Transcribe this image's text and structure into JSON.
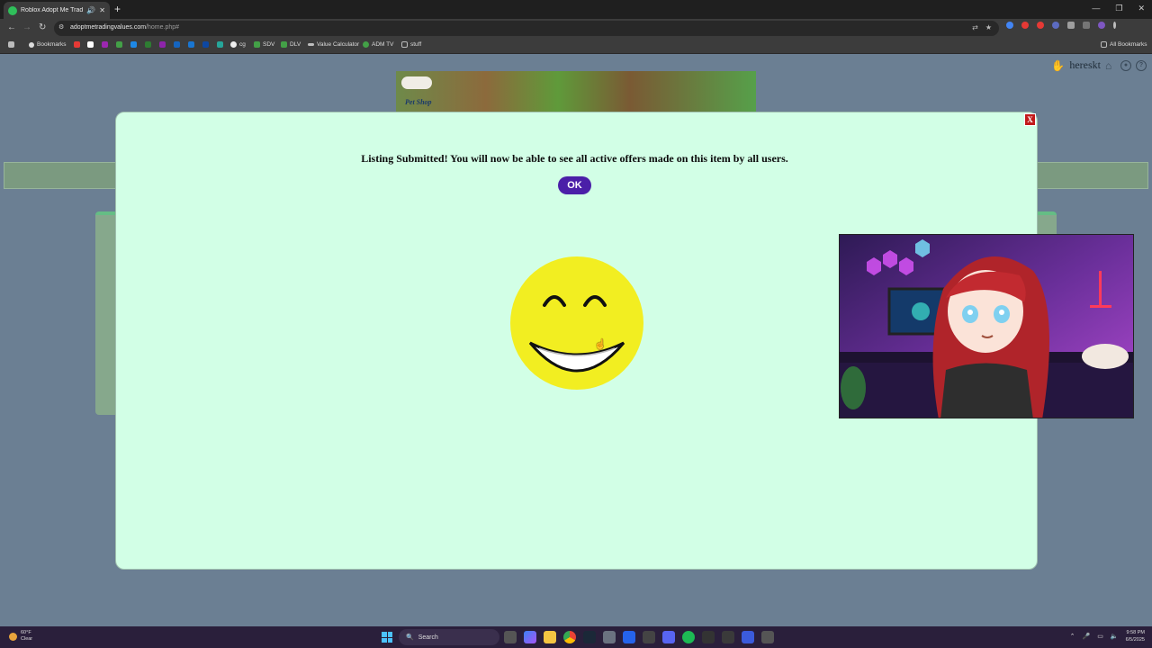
{
  "browser": {
    "tab_title": "Roblox Adopt Me Trading V",
    "url_host": "adoptmetradingvalues.com",
    "url_path": "/home.php#",
    "bookmarks": [
      {
        "label": "Bookmarks",
        "color": "#dddddd"
      },
      {
        "label": "",
        "color": "#e53935"
      },
      {
        "label": "",
        "color": "#ffffff"
      },
      {
        "label": "",
        "color": "#9c27b0"
      },
      {
        "label": "",
        "color": "#43a047"
      },
      {
        "label": "",
        "color": "#1e88e5"
      },
      {
        "label": "",
        "color": "#2e7d32"
      },
      {
        "label": "",
        "color": "#8e24aa"
      },
      {
        "label": "",
        "color": "#1565c0"
      },
      {
        "label": "",
        "color": "#1976d2"
      },
      {
        "label": "",
        "color": "#0d47a1"
      },
      {
        "label": "",
        "color": "#64b5f6"
      },
      {
        "label": "",
        "color": "#26a69a"
      },
      {
        "label": "cg",
        "color": "#eeeeee"
      },
      {
        "label": "SDV",
        "color": "#43a047"
      },
      {
        "label": "DLV",
        "color": "#43a047"
      },
      {
        "label": "Value Calculator",
        "color": "#bdbdbd"
      },
      {
        "label": "ADM TV",
        "color": "#43a047"
      },
      {
        "label": "stuff",
        "color": "#bdbdbd"
      }
    ],
    "all_bookmarks": "All Bookmarks"
  },
  "page": {
    "username": "hereskt",
    "hero_text": "Pet Shop"
  },
  "modal": {
    "message": "Listing Submitted! You will now be able to see all active offers made on this item by all users.",
    "ok_label": "OK",
    "close_label": "X"
  },
  "taskbar": {
    "weather_temp": "60°F",
    "weather_cond": "Clear",
    "search_label": "Search",
    "time": "9:58 PM",
    "date": "6/5/2025"
  },
  "colors": {
    "modal_bg": "#d2ffe6",
    "ok_button": "#4b1fa8",
    "close_button": "#c21a1a",
    "page_bg": "#6b7f93"
  }
}
